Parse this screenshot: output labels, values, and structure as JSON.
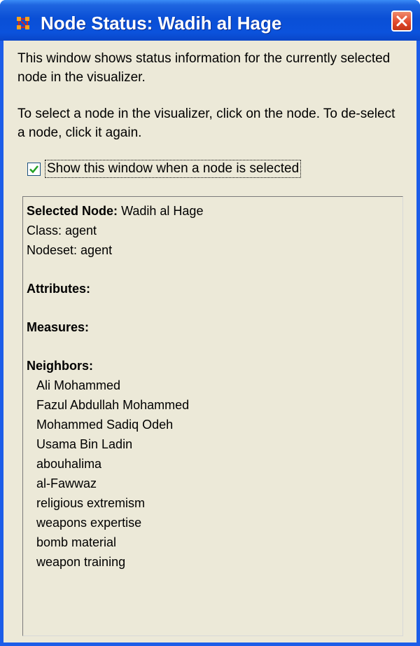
{
  "window": {
    "title": "Node Status: Wadih al Hage",
    "app_icon": "node-network-icon",
    "close_icon": "close-icon"
  },
  "description": {
    "line1": "This window shows status information for the currently selected node in the visualizer.",
    "line2": "To select a node in the visualizer, click on the node. To de-select a node, click it again."
  },
  "checkbox": {
    "label": "Show this window when a node is selected",
    "checked": true
  },
  "status": {
    "selected_node_label": "Selected Node:",
    "selected_node_value": "Wadih al Hage",
    "class_line": "Class: agent",
    "nodeset_line": "Nodeset: agent",
    "attributes_heading": "Attributes:",
    "measures_heading": "Measures:",
    "neighbors_heading": "Neighbors:",
    "neighbors": [
      "Ali Mohammed",
      "Fazul Abdullah Mohammed",
      "Mohammed Sadiq Odeh",
      "Usama Bin Ladin",
      "abouhalima",
      "al-Fawwaz",
      "religious extremism",
      "weapons expertise",
      "bomb material",
      "weapon training"
    ]
  },
  "colors": {
    "titlebar": "#0a4fd6",
    "window_body": "#ece9d8",
    "close_button": "#e0472a",
    "checkmark": "#21a121"
  }
}
